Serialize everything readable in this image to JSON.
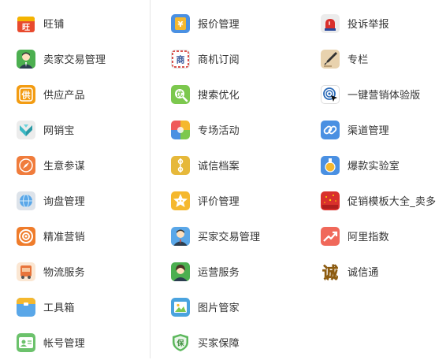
{
  "columns": [
    {
      "items": [
        {
          "label": "旺铺",
          "icon": "shop-icon",
          "color": "#e84a2e"
        },
        {
          "label": "卖家交易管理",
          "icon": "seller-avatar-icon",
          "color": "#4caf50"
        },
        {
          "label": "供应产品",
          "icon": "supply-icon",
          "color": "#f39c12"
        },
        {
          "label": "网销宝",
          "icon": "wangxiaobao-icon",
          "color": "#e0e0e0"
        },
        {
          "label": "生意参谋",
          "icon": "compass-icon",
          "color": "#f07c3c"
        },
        {
          "label": "询盘管理",
          "icon": "globe-icon",
          "color": "#dde3ea"
        },
        {
          "label": "精准营销",
          "icon": "target-icon",
          "color": "#ef7c2b"
        },
        {
          "label": "物流服务",
          "icon": "truck-icon",
          "color": "#f0c090"
        },
        {
          "label": "工具箱",
          "icon": "toolbox-icon",
          "color": "#f5b82e"
        },
        {
          "label": "帐号管理",
          "icon": "id-card-icon",
          "color": "#6cc26c"
        }
      ]
    },
    {
      "items": [
        {
          "label": "报价管理",
          "icon": "price-tag-icon",
          "color": "#4a90e2"
        },
        {
          "label": "商机订阅",
          "icon": "envelope-icon",
          "color": "#d9534f"
        },
        {
          "label": "搜索优化",
          "icon": "search-optimize-icon",
          "color": "#7cc84e"
        },
        {
          "label": "专场活动",
          "icon": "pinwheel-icon",
          "color": "#ef5a5a"
        },
        {
          "label": "诚信档案",
          "icon": "archive-icon",
          "color": "#e6b83a"
        },
        {
          "label": "评价管理",
          "icon": "star-icon",
          "color": "#f5b82e"
        },
        {
          "label": "买家交易管理",
          "icon": "buyer-avatar-icon",
          "color": "#5aa7e8"
        },
        {
          "label": "运营服务",
          "icon": "operator-avatar-icon",
          "color": "#4caf50"
        },
        {
          "label": "图片管家",
          "icon": "image-icon",
          "color": "#4aa3df"
        },
        {
          "label": "买家保障",
          "icon": "shield-icon",
          "color": "#5cb85c"
        }
      ]
    },
    {
      "items": [
        {
          "label": "投诉举报",
          "icon": "alarm-icon",
          "color": "#e8e8e8"
        },
        {
          "label": "专栏",
          "icon": "pen-icon",
          "color": "#d9b98a"
        },
        {
          "label": "一键营销体验版",
          "icon": "cursor-target-icon",
          "color": "#ffffff"
        },
        {
          "label": "渠道管理",
          "icon": "link-icon",
          "color": "#4a90e2"
        },
        {
          "label": "爆款实验室",
          "icon": "flask-icon",
          "color": "#4a90e2"
        },
        {
          "label": "促销模板大全_卖多",
          "icon": "promo-template-icon",
          "color": "#d9302c"
        },
        {
          "label": "阿里指数",
          "icon": "trend-icon",
          "color": "#f0685a"
        },
        {
          "label": "诚信通",
          "icon": "chengxin-icon",
          "color": "#f5a623"
        }
      ]
    }
  ]
}
